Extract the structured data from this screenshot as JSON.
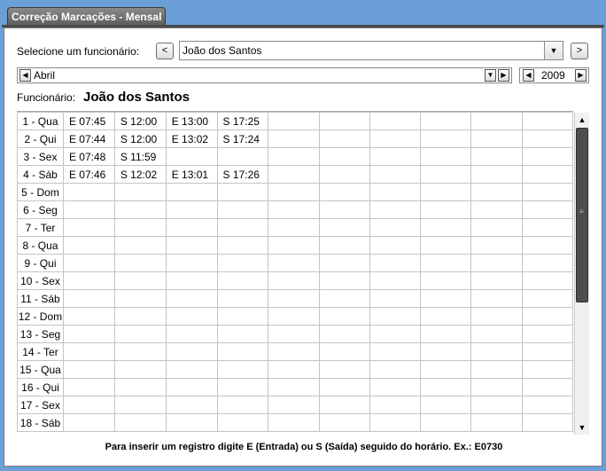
{
  "tab": {
    "title": "Correção Marcações - Mensal"
  },
  "selector": {
    "label": "Selecione um funcionário:",
    "prev_label": "<",
    "next_label": ">",
    "employee": "João dos Santos"
  },
  "month": {
    "value": "Abril"
  },
  "year": {
    "value": "2009"
  },
  "employee_info": {
    "label": "Funcionário:",
    "name": "João dos Santos"
  },
  "grid": {
    "rows": [
      {
        "day": "1 - Qua",
        "entries": [
          "E 07:45",
          "S 12:00",
          "E 13:00",
          "S 17:25"
        ]
      },
      {
        "day": "2 - Qui",
        "entries": [
          "E 07:44",
          "S 12:00",
          "E 13:02",
          "S 17:24"
        ]
      },
      {
        "day": "3 - Sex",
        "entries": [
          "E 07:48",
          "S 11:59"
        ]
      },
      {
        "day": "4 - Sáb",
        "entries": [
          "E 07:46",
          "S 12:02",
          "E 13:01",
          "S 17:26"
        ]
      },
      {
        "day": "5 - Dom",
        "entries": []
      },
      {
        "day": "6 - Seg",
        "entries": []
      },
      {
        "day": "7 - Ter",
        "entries": []
      },
      {
        "day": "8 - Qua",
        "entries": []
      },
      {
        "day": "9 - Qui",
        "entries": []
      },
      {
        "day": "10 - Sex",
        "entries": []
      },
      {
        "day": "11 - Sáb",
        "entries": []
      },
      {
        "day": "12 - Dom",
        "entries": []
      },
      {
        "day": "13 - Seg",
        "entries": []
      },
      {
        "day": "14 - Ter",
        "entries": []
      },
      {
        "day": "15 - Qua",
        "entries": []
      },
      {
        "day": "16 - Qui",
        "entries": []
      },
      {
        "day": "17 - Sex",
        "entries": []
      },
      {
        "day": "18 - Sáb",
        "entries": []
      }
    ]
  },
  "hint": "Para inserir um registro digite E (Entrada) ou S (Saída) seguido do horário. Ex.: E0730",
  "icons": {
    "dropdown": "chevron-down-icon",
    "scroll_up": "arrow-up-icon",
    "scroll_down": "arrow-down-icon"
  },
  "colors": {
    "background": "#6b9fd8",
    "tab": "#6e6e6e",
    "thumb": "#4e4e4e"
  }
}
